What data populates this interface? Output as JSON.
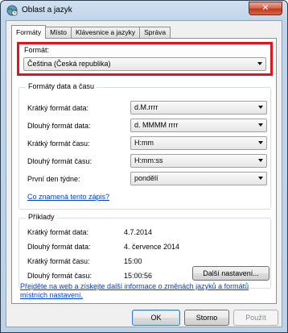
{
  "window": {
    "title": "Oblast a jazyk",
    "close_label": "✕",
    "app_icon": "globe-clock-icon"
  },
  "tabs": [
    {
      "label": "Formáty",
      "active": true
    },
    {
      "label": "Místo",
      "active": false
    },
    {
      "label": "Klávesnice a jazyky",
      "active": false
    },
    {
      "label": "Správa",
      "active": false
    }
  ],
  "format": {
    "label": "Formát:",
    "value": "Čeština (Česká republika)"
  },
  "datetime": {
    "group_title": "Formáty data a času",
    "rows": [
      {
        "label": "Krátký formát data:",
        "value": "d.M.rrrr"
      },
      {
        "label": "Dlouhý formát data:",
        "value": "d. MMMM rrrr"
      },
      {
        "label": "Krátký formát času:",
        "value": "H:mm"
      },
      {
        "label": "Dlouhý formát času:",
        "value": "H:mm:ss"
      },
      {
        "label": "První den týdne:",
        "value": "pondělí"
      }
    ],
    "help_link": "Co znamená tento zápis?"
  },
  "examples": {
    "group_title": "Příklady",
    "rows": [
      {
        "label": "Krátký formát data:",
        "value": "4.7.2014"
      },
      {
        "label": "Dlouhý formát data:",
        "value": "4. července 2014"
      },
      {
        "label": "Krátký formát času:",
        "value": "15:00"
      },
      {
        "label": "Dlouhý formát času:",
        "value": "15:00:56"
      }
    ]
  },
  "more_settings_label": "Další nastavení...",
  "web_link_line1": "Přejděte na web a získejte další informace o změnách jazyků a formátů",
  "web_link_line2": "místních nastavení.",
  "buttons": {
    "ok": "OK",
    "cancel": "Storno",
    "apply": "Použít"
  },
  "colors": {
    "highlight": "#e1151b",
    "link": "#0044cc"
  }
}
